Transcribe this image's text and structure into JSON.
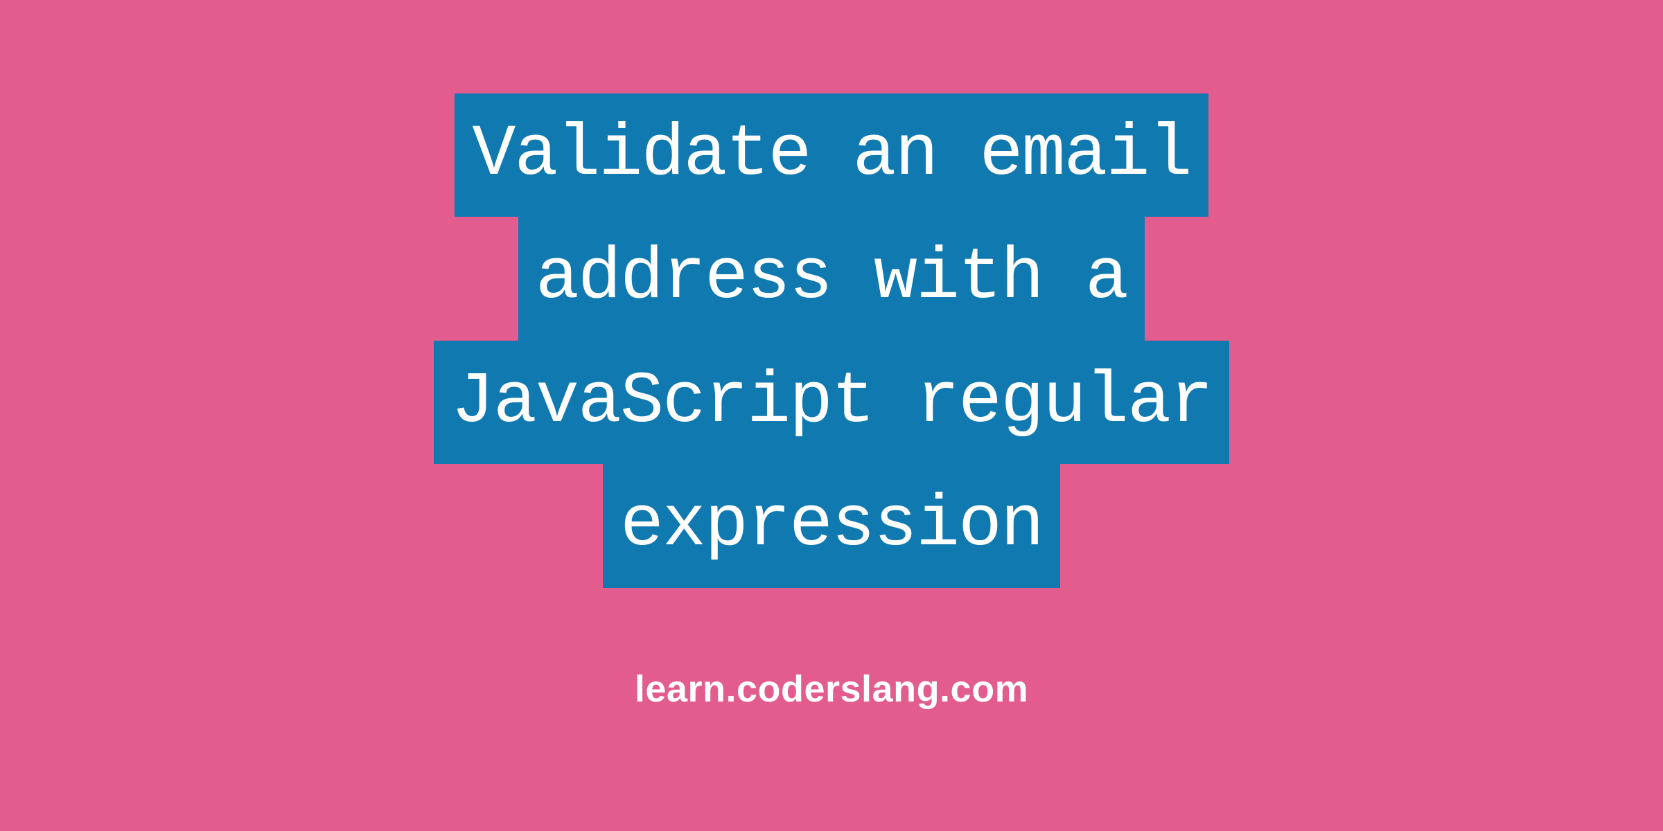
{
  "title": {
    "line1": "Validate an email",
    "line2": "address with a",
    "line3": "JavaScript regular",
    "line4": "expression"
  },
  "footer": "learn.coderslang.com",
  "colors": {
    "background": "#e25c8d",
    "highlight": "#0f79b0",
    "text": "#ffffff"
  }
}
